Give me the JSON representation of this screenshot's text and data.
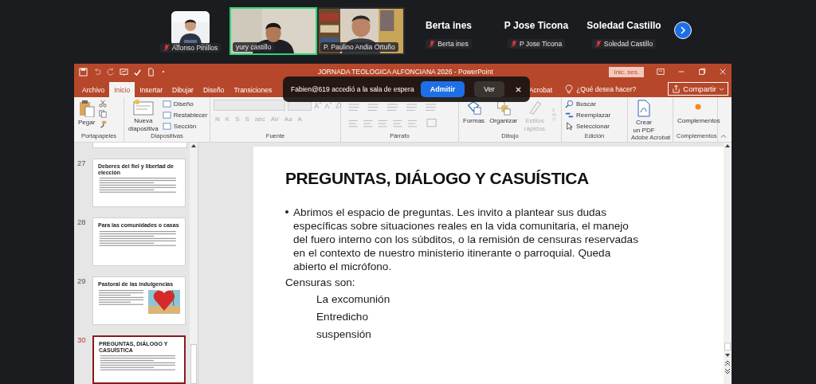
{
  "meeting": {
    "participants": [
      {
        "kind": "avatar",
        "label": "Alfonso Pinillos",
        "muted": true
      },
      {
        "kind": "video",
        "label": "yury castillo",
        "muted": false,
        "active_speaker": true
      },
      {
        "kind": "video",
        "label": "P. Paulino Andia Ortuño",
        "muted": false,
        "active_speaker": false
      },
      {
        "kind": "name",
        "display_name": "Berta ines",
        "label": "Berta ines",
        "muted": true
      },
      {
        "kind": "name",
        "display_name": "P Jose Ticona",
        "label": "P Jose Ticona",
        "muted": true
      },
      {
        "kind": "name",
        "display_name": "Soledad Castillo",
        "label": "Soledad Castillo",
        "muted": true
      }
    ],
    "notification": {
      "message": "Fabien@619 accedió a la sala de espera",
      "admit": "Admitir",
      "view": "Ver"
    }
  },
  "powerpoint": {
    "title": "JORNADA TEOLOGICA ALFONCIANA 2026  -  PowerPoint",
    "sign_in": "Inic. ses.",
    "tabs": [
      {
        "label": "Archivo",
        "selected": false
      },
      {
        "label": "Inicio",
        "selected": true
      },
      {
        "label": "Insertar",
        "selected": false
      },
      {
        "label": "Dibujar",
        "selected": false
      },
      {
        "label": "Diseño",
        "selected": false
      },
      {
        "label": "Transiciones",
        "selected": false
      },
      {
        "label": "Acrobat",
        "selected": false
      }
    ],
    "tell_me": "¿Qué desea hacer?",
    "share": "Compartir",
    "ribbon": [
      {
        "kind": "clipboard",
        "label": "Portapapeles",
        "items": [
          {
            "label": "Pegar"
          }
        ]
      },
      {
        "kind": "slides",
        "label": "Diapositivas",
        "items": [
          {
            "label": "Nueva diapositiva"
          },
          {
            "label": "Diseño"
          },
          {
            "label": "Restablecer"
          },
          {
            "label": "Sección"
          }
        ]
      },
      {
        "kind": "font",
        "label": "Fuente",
        "disabled": true,
        "items": [
          {
            "label": "N"
          },
          {
            "label": "K"
          },
          {
            "label": "S"
          },
          {
            "label": "S"
          },
          {
            "label": "abc"
          },
          {
            "label": "AV"
          },
          {
            "label": "Aa"
          },
          {
            "label": "A"
          }
        ]
      },
      {
        "kind": "paragraph",
        "label": "Párrafo"
      },
      {
        "kind": "drawing",
        "label": "Dibujo",
        "items": [
          {
            "label": "Formas",
            "disabled": false
          },
          {
            "label": "Organizar",
            "disabled": false
          },
          {
            "label": "Estilos rápidos",
            "disabled": true
          }
        ]
      },
      {
        "kind": "editing",
        "label": "Edición",
        "items": [
          {
            "label": "Buscar"
          },
          {
            "label": "Reemplazar"
          },
          {
            "label": "Seleccionar"
          }
        ]
      },
      {
        "kind": "acrobat",
        "label": "Adobe Acrobat",
        "items": [
          {
            "label": "Crear un PDF"
          }
        ]
      },
      {
        "kind": "addins",
        "label": "Complementos",
        "items": [
          {
            "label": "Complementos"
          }
        ]
      }
    ],
    "thumbnails": [
      {
        "number": "27",
        "title": "Deberes del fiel y libertad de elección",
        "selected": false
      },
      {
        "number": "28",
        "title": "Para las comunidades o casas",
        "selected": false
      },
      {
        "number": "29",
        "title": "Pastoral de las indulgencias",
        "selected": false,
        "has_picture": true
      },
      {
        "number": "30",
        "title": "PREGUNTAS, DIÁLOGO Y CASUÍSTICA",
        "selected": true
      }
    ],
    "slide": {
      "title": "PREGUNTAS, DIÁLOGO Y CASUÍSTICA",
      "bullet": "Abrimos el espacio de preguntas. Les invito a plantear sus dudas específicas sobre situaciones reales en la vida comunitaria, el manejo del fuero interno con los súbditos, o la remisión de censuras reservadas en el contexto de nuestro ministerio itinerante o parroquial. Queda abierto el micrófono.",
      "heading": "Censuras son:",
      "items": [
        "La excomunión",
        "Entredicho",
        "suspensión"
      ]
    }
  }
}
